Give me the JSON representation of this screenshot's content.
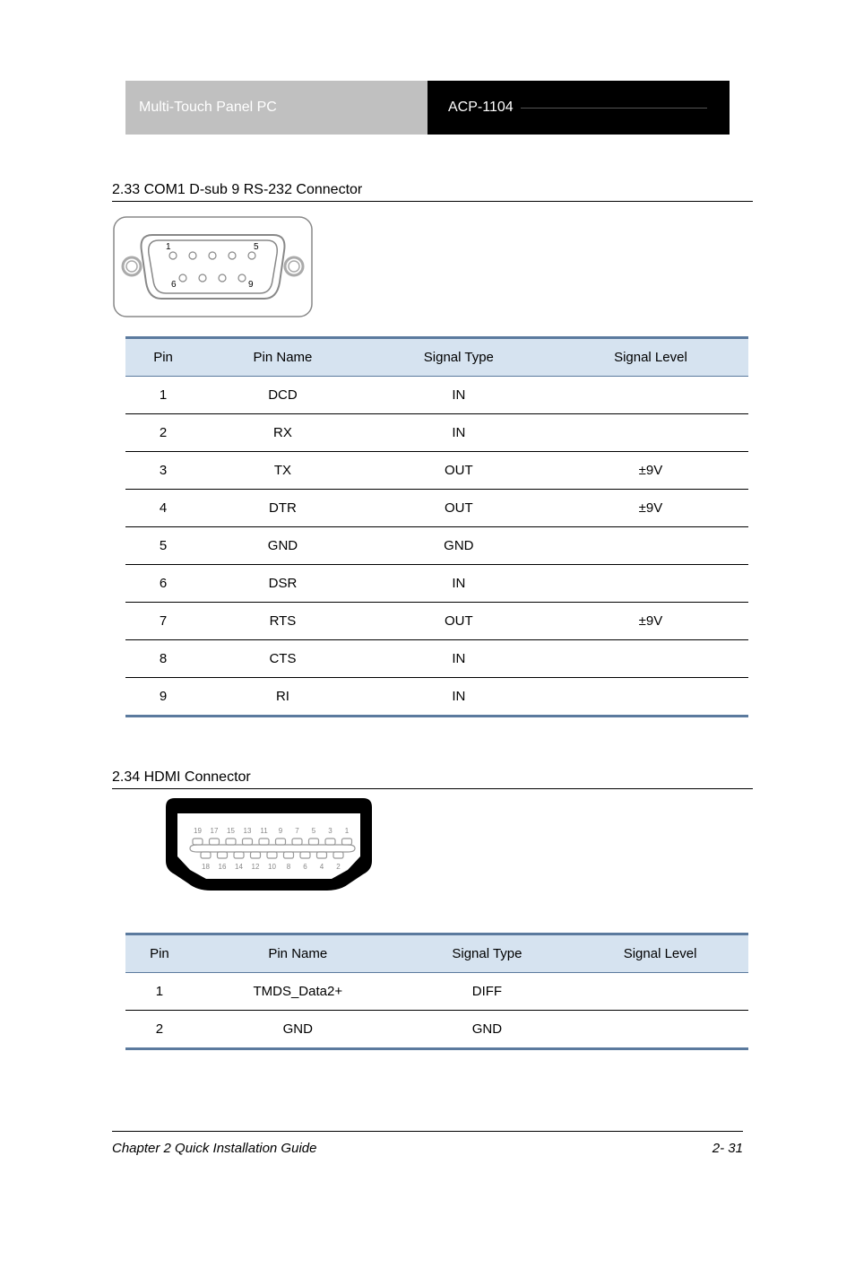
{
  "header": {
    "left": "Multi-Touch Panel PC",
    "right": "ACP-1104"
  },
  "section1": {
    "title": "2.33 COM1 D-sub 9 RS-232 Connector",
    "table": {
      "headers": [
        "Pin",
        "Pin Name",
        "Signal Type",
        "Signal Level"
      ],
      "rows": [
        {
          "pin": "1",
          "name": "DCD",
          "type": "IN",
          "level": ""
        },
        {
          "pin": "2",
          "name": "RX",
          "type": "IN",
          "level": ""
        },
        {
          "pin": "3",
          "name": "TX",
          "type": "OUT",
          "level": "±9V"
        },
        {
          "pin": "4",
          "name": "DTR",
          "type": "OUT",
          "level": "±9V"
        },
        {
          "pin": "5",
          "name": "GND",
          "type": "GND",
          "level": ""
        },
        {
          "pin": "6",
          "name": "DSR",
          "type": "IN",
          "level": ""
        },
        {
          "pin": "7",
          "name": "RTS",
          "type": "OUT",
          "level": "±9V"
        },
        {
          "pin": "8",
          "name": "CTS",
          "type": "IN",
          "level": ""
        },
        {
          "pin": "9",
          "name": "RI",
          "type": "IN",
          "level": ""
        }
      ]
    }
  },
  "section2": {
    "title": "2.34 HDMI Connector",
    "table": {
      "headers": [
        "Pin",
        "Pin Name",
        "Signal Type",
        "Signal Level"
      ],
      "rows": [
        {
          "pin": "1",
          "name": "TMDS_Data2+",
          "type": "DIFF",
          "level": ""
        },
        {
          "pin": "2",
          "name": "GND",
          "type": "GND",
          "level": ""
        }
      ]
    }
  },
  "footer": {
    "text": "Chapter 2 Quick Installation Guide",
    "page": "2- 31"
  },
  "pins": {
    "db9_top": [
      "1",
      "5"
    ],
    "db9_bottom": [
      "6",
      "9"
    ],
    "hdmi_top": [
      "19",
      "17",
      "15",
      "13",
      "11",
      "9",
      "7",
      "5",
      "3",
      "1"
    ],
    "hdmi_bottom": [
      "18",
      "16",
      "14",
      "12",
      "10",
      "8",
      "6",
      "4",
      "2"
    ]
  }
}
